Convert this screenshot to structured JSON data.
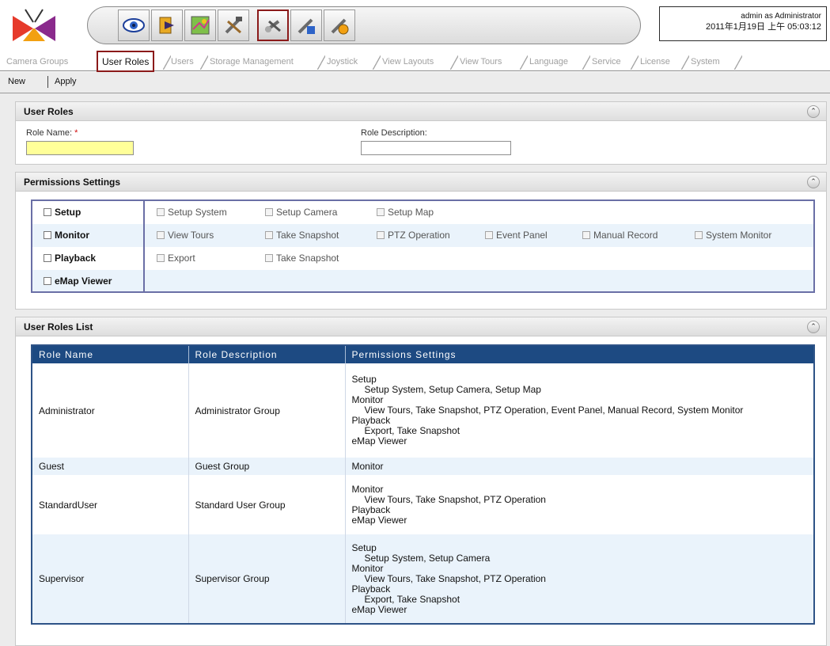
{
  "header": {
    "user_line": "admin as Administrator",
    "datetime": "2011年1月19日 上午 05:03:12",
    "toolbar_icons": [
      "live-view-icon",
      "playback-icon",
      "emap-icon",
      "setup-tools-icon",
      "user-admin-icon",
      "system-tools-icon",
      "maintenance-icon"
    ]
  },
  "tabs": [
    "Camera Groups",
    "User Roles",
    "Users",
    "Storage Management",
    "Joystick",
    "View Layouts",
    "View Tours",
    "Language",
    "Service",
    "License",
    "System"
  ],
  "actions": {
    "new": "New",
    "apply": "Apply"
  },
  "user_roles_panel": {
    "title": "User Roles",
    "role_name_label": "Role Name:",
    "required_mark": "*",
    "role_name_value": "",
    "role_description_label": "Role Description:",
    "role_description_value": ""
  },
  "permissions_panel": {
    "title": "Permissions Settings",
    "groups": [
      {
        "label": "Setup",
        "items": [
          "Setup System",
          "Setup Camera",
          "Setup Map"
        ]
      },
      {
        "label": "Monitor",
        "items": [
          "View Tours",
          "Take Snapshot",
          "PTZ Operation",
          "Event Panel",
          "Manual Record",
          "System Monitor"
        ]
      },
      {
        "label": "Playback",
        "items": [
          "Export",
          "Take Snapshot"
        ]
      },
      {
        "label": "eMap Viewer",
        "items": []
      }
    ]
  },
  "roles_list": {
    "title": "User Roles List",
    "columns": [
      "Role Name",
      "Role Description",
      "Permissions Settings"
    ],
    "rows": [
      {
        "name": "Administrator",
        "description": "Administrator Group",
        "perms": [
          {
            "group": "Setup",
            "items": "Setup System, Setup Camera, Setup Map"
          },
          {
            "group": "Monitor",
            "items": "View Tours, Take Snapshot, PTZ Operation, Event Panel, Manual Record, System Monitor"
          },
          {
            "group": "Playback",
            "items": "Export, Take Snapshot"
          },
          {
            "group": "eMap Viewer",
            "items": ""
          }
        ]
      },
      {
        "name": "Guest",
        "description": "Guest Group",
        "perms": [
          {
            "group": "Monitor",
            "items": ""
          }
        ]
      },
      {
        "name": "StandardUser",
        "description": "Standard User Group",
        "perms": [
          {
            "group": "Monitor",
            "items": "View Tours, Take Snapshot, PTZ Operation"
          },
          {
            "group": "Playback",
            "items": ""
          },
          {
            "group": "eMap Viewer",
            "items": ""
          }
        ]
      },
      {
        "name": "Supervisor",
        "description": "Supervisor Group",
        "perms": [
          {
            "group": "Setup",
            "items": "Setup System, Setup Camera"
          },
          {
            "group": "Monitor",
            "items": "View Tours, Take Snapshot, PTZ Operation"
          },
          {
            "group": "Playback",
            "items": "Export, Take Snapshot"
          },
          {
            "group": "eMap Viewer",
            "items": ""
          }
        ]
      }
    ]
  }
}
